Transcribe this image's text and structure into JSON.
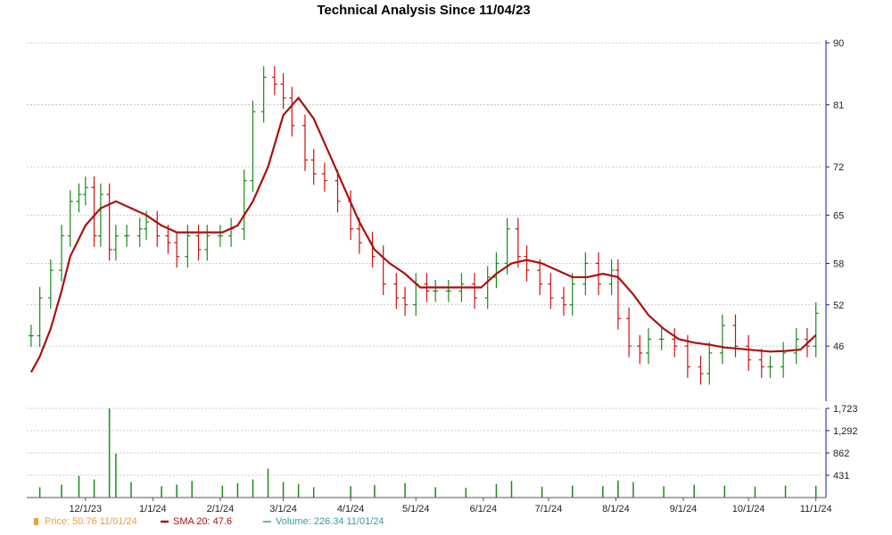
{
  "chart_data": {
    "type": "ohlc",
    "title": "Technical Analysis Since 11/04/23",
    "grid": true,
    "colors": {
      "up": "#1a8a1a",
      "down": "#cc1111",
      "sma": "#aa1111",
      "volume": "#1a8a1a",
      "price_legend": "#e8a040",
      "volume_legend": "#3a9a9a",
      "axis": "#1a1a9a"
    },
    "price_axis": {
      "ylim": [
        38,
        90
      ],
      "ticks": [
        46,
        52,
        58,
        65,
        72,
        81,
        90
      ],
      "tick_labels": [
        "46",
        "52",
        "58",
        "65",
        "72",
        "81",
        "90"
      ]
    },
    "volume_axis": {
      "ylim": [
        0,
        1723
      ],
      "ticks": [
        431,
        862,
        1292,
        1723
      ],
      "tick_labels": [
        "431",
        "862",
        "1,292",
        "1,723"
      ]
    },
    "x_axis": {
      "start": "11/04/23",
      "ticks": [
        "12/1/23",
        "1/1/24",
        "2/1/24",
        "3/1/24",
        "4/1/24",
        "5/1/24",
        "6/1/24",
        "7/1/24",
        "8/1/24",
        "9/1/24",
        "10/1/24",
        "11/1/24"
      ],
      "tick_labels": [
        "12/1/23",
        "1/1/24",
        "2/1/24",
        "3/1/24",
        "4/1/24",
        "5/1/24",
        "6/1/24",
        "7/1/24",
        "8/1/24",
        "9/1/24",
        "10/1/24",
        "11/1/24"
      ]
    },
    "price_series": [
      [
        "11/06/23",
        47.5
      ],
      [
        "11/10/23",
        53
      ],
      [
        "11/15/23",
        57
      ],
      [
        "11/20/23",
        62
      ],
      [
        "11/24/23",
        67
      ],
      [
        "11/28/23",
        68
      ],
      [
        "12/01/23",
        69
      ],
      [
        "12/05/23",
        62
      ],
      [
        "12/08/23",
        68
      ],
      [
        "12/12/23",
        60
      ],
      [
        "12/15/23",
        62
      ],
      [
        "12/20/23",
        62
      ],
      [
        "12/26/23",
        63
      ],
      [
        "12/29/23",
        64
      ],
      [
        "01/03/24",
        62
      ],
      [
        "01/08/24",
        61
      ],
      [
        "01/12/24",
        59
      ],
      [
        "01/17/24",
        62
      ],
      [
        "01/22/24",
        60
      ],
      [
        "01/26/24",
        62
      ],
      [
        "02/01/24",
        62
      ],
      [
        "02/06/24",
        63
      ],
      [
        "02/12/24",
        70
      ],
      [
        "02/16/24",
        80
      ],
      [
        "02/21/24",
        85
      ],
      [
        "02/26/24",
        84
      ],
      [
        "03/01/24",
        82
      ],
      [
        "03/05/24",
        78
      ],
      [
        "03/11/24",
        73
      ],
      [
        "03/15/24",
        71
      ],
      [
        "03/20/24",
        70
      ],
      [
        "03/26/24",
        67
      ],
      [
        "04/01/24",
        63
      ],
      [
        "04/05/24",
        61
      ],
      [
        "04/11/24",
        59
      ],
      [
        "04/16/24",
        55
      ],
      [
        "04/22/24",
        53
      ],
      [
        "04/26/24",
        52
      ],
      [
        "05/01/24",
        55
      ],
      [
        "05/06/24",
        54
      ],
      [
        "05/10/24",
        54
      ],
      [
        "05/16/24",
        54
      ],
      [
        "05/22/24",
        55
      ],
      [
        "05/28/24",
        53
      ],
      [
        "06/03/24",
        56
      ],
      [
        "06/07/24",
        58
      ],
      [
        "06/12/24",
        63
      ],
      [
        "06/17/24",
        59
      ],
      [
        "06/21/24",
        57
      ],
      [
        "06/27/24",
        55
      ],
      [
        "07/02/24",
        53
      ],
      [
        "07/08/24",
        52
      ],
      [
        "07/12/24",
        55
      ],
      [
        "07/18/24",
        58
      ],
      [
        "07/24/24",
        55
      ],
      [
        "07/30/24",
        57
      ],
      [
        "08/02/24",
        50
      ],
      [
        "08/07/24",
        46
      ],
      [
        "08/12/24",
        45
      ],
      [
        "08/16/24",
        47
      ],
      [
        "08/22/24",
        47
      ],
      [
        "08/28/24",
        46
      ],
      [
        "09/03/24",
        43
      ],
      [
        "09/09/24",
        42
      ],
      [
        "09/13/24",
        45
      ],
      [
        "09/19/24",
        49
      ],
      [
        "09/25/24",
        46
      ],
      [
        "10/01/24",
        44
      ],
      [
        "10/07/24",
        43
      ],
      [
        "10/11/24",
        43
      ],
      [
        "10/17/24",
        45
      ],
      [
        "10/23/24",
        47
      ],
      [
        "10/28/24",
        46
      ],
      [
        "11/01/24",
        50.76
      ]
    ],
    "sma_series": [
      [
        "11/06/23",
        42.2
      ],
      [
        "11/10/23",
        44.5
      ],
      [
        "11/15/23",
        48.5
      ],
      [
        "11/20/23",
        54
      ],
      [
        "11/24/23",
        59
      ],
      [
        "12/01/23",
        63.5
      ],
      [
        "12/08/23",
        66
      ],
      [
        "12/15/23",
        67
      ],
      [
        "12/22/23",
        66
      ],
      [
        "12/29/23",
        65
      ],
      [
        "01/05/24",
        63.5
      ],
      [
        "01/12/24",
        62.5
      ],
      [
        "01/19/24",
        62.5
      ],
      [
        "01/26/24",
        62.5
      ],
      [
        "02/02/24",
        62.5
      ],
      [
        "02/09/24",
        63.5
      ],
      [
        "02/16/24",
        67
      ],
      [
        "02/23/24",
        72
      ],
      [
        "03/01/24",
        79.5
      ],
      [
        "03/08/24",
        82
      ],
      [
        "03/15/24",
        79
      ],
      [
        "03/22/24",
        74
      ],
      [
        "03/29/24",
        69
      ],
      [
        "04/05/24",
        64
      ],
      [
        "04/12/24",
        60
      ],
      [
        "04/19/24",
        58
      ],
      [
        "04/26/24",
        56.5
      ],
      [
        "05/03/24",
        54.5
      ],
      [
        "05/10/24",
        54.5
      ],
      [
        "05/17/24",
        54.5
      ],
      [
        "05/24/24",
        54.5
      ],
      [
        "05/31/24",
        54.5
      ],
      [
        "06/07/24",
        56.5
      ],
      [
        "06/14/24",
        58
      ],
      [
        "06/21/24",
        58.5
      ],
      [
        "06/28/24",
        58
      ],
      [
        "07/05/24",
        57
      ],
      [
        "07/12/24",
        56
      ],
      [
        "07/19/24",
        56
      ],
      [
        "07/26/24",
        56.5
      ],
      [
        "08/02/24",
        56
      ],
      [
        "08/09/24",
        53.5
      ],
      [
        "08/16/24",
        50.5
      ],
      [
        "08/23/24",
        48.5
      ],
      [
        "08/30/24",
        47
      ],
      [
        "09/06/24",
        46.5
      ],
      [
        "09/13/24",
        46.2
      ],
      [
        "09/20/24",
        45.8
      ],
      [
        "09/27/24",
        45.6
      ],
      [
        "10/04/24",
        45.4
      ],
      [
        "10/11/24",
        45.2
      ],
      [
        "10/18/24",
        45.3
      ],
      [
        "10/25/24",
        45.5
      ],
      [
        "11/01/24",
        47.6
      ]
    ],
    "volume_series": [
      [
        "11/10/23",
        200
      ],
      [
        "11/20/23",
        250
      ],
      [
        "11/28/23",
        420
      ],
      [
        "12/05/23",
        350
      ],
      [
        "12/12/23",
        1723
      ],
      [
        "12/15/23",
        850
      ],
      [
        "12/22/23",
        300
      ],
      [
        "01/05/24",
        220
      ],
      [
        "01/12/24",
        250
      ],
      [
        "01/19/24",
        320
      ],
      [
        "02/02/24",
        230
      ],
      [
        "02/09/24",
        280
      ],
      [
        "02/16/24",
        350
      ],
      [
        "02/23/24",
        560
      ],
      [
        "03/01/24",
        300
      ],
      [
        "03/08/24",
        260
      ],
      [
        "03/15/24",
        200
      ],
      [
        "04/01/24",
        220
      ],
      [
        "04/12/24",
        240
      ],
      [
        "04/26/24",
        280
      ],
      [
        "05/10/24",
        200
      ],
      [
        "05/24/24",
        190
      ],
      [
        "06/07/24",
        260
      ],
      [
        "06/14/24",
        320
      ],
      [
        "06/28/24",
        210
      ],
      [
        "07/12/24",
        230
      ],
      [
        "07/26/24",
        220
      ],
      [
        "08/02/24",
        330
      ],
      [
        "08/09/24",
        300
      ],
      [
        "08/23/24",
        220
      ],
      [
        "09/06/24",
        250
      ],
      [
        "09/20/24",
        230
      ],
      [
        "10/04/24",
        210
      ],
      [
        "10/18/24",
        230
      ],
      [
        "11/01/24",
        226.34
      ]
    ],
    "legend": [
      {
        "key": "price",
        "label": "Price: 50.76  11/01/24"
      },
      {
        "key": "sma",
        "label": "SMA 20: 47.6"
      },
      {
        "key": "volume",
        "label": "Volume: 226.34  11/01/24"
      }
    ]
  }
}
